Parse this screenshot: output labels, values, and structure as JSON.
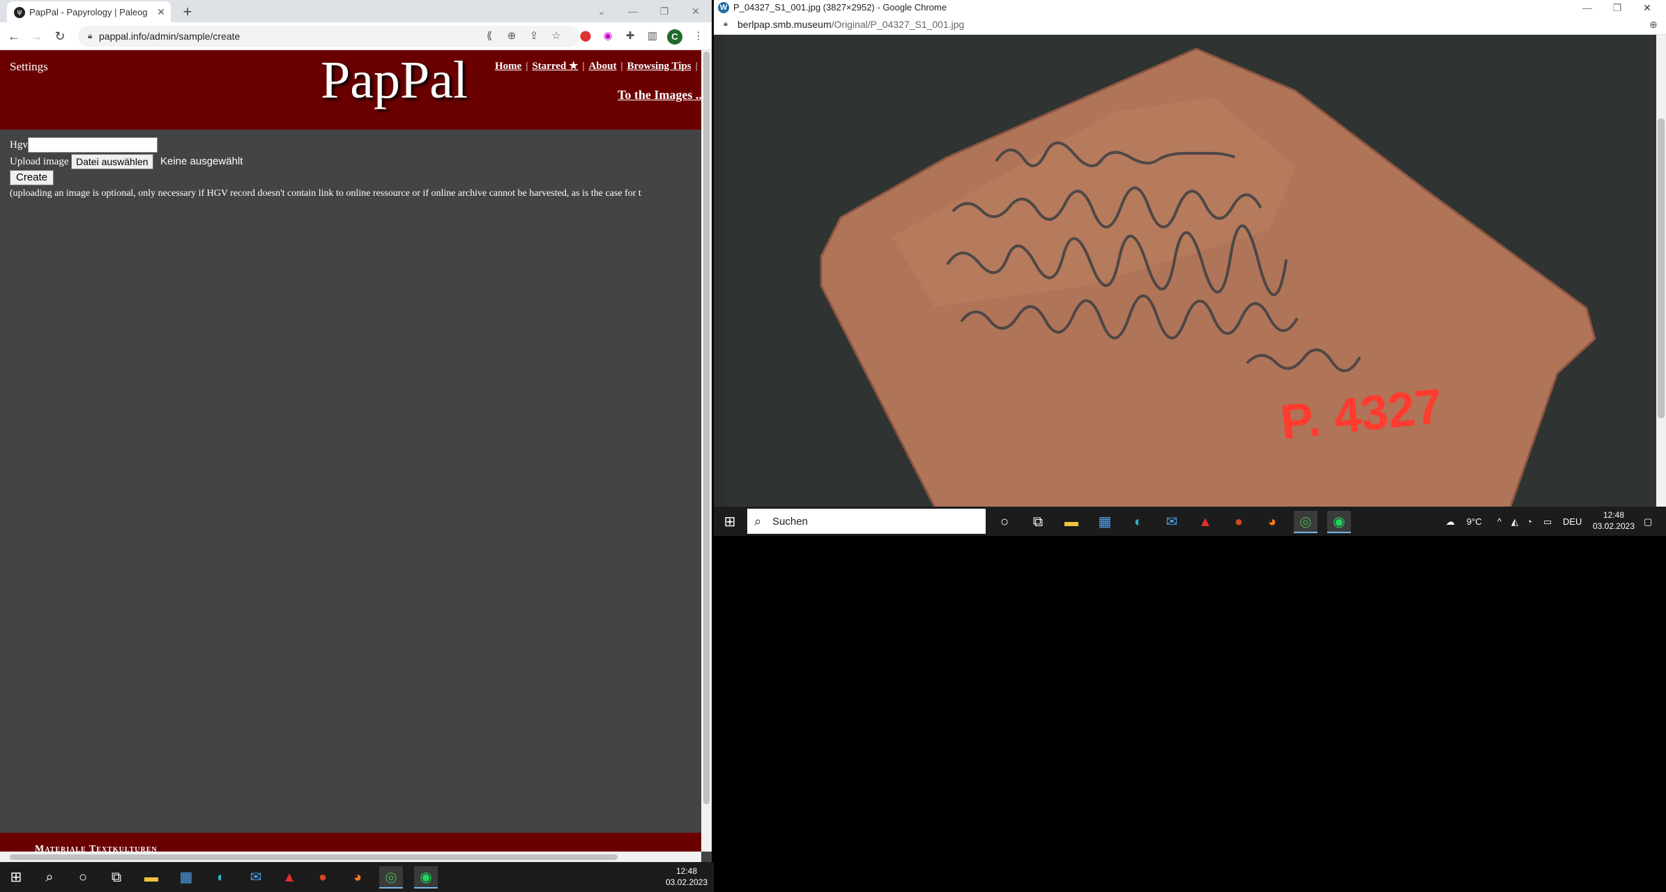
{
  "left_window": {
    "tab_title": "PapPal - Papyrology | Paleography",
    "tab_favicon": "ψ",
    "url": "pappal.info/admin/sample/create",
    "avatar_letter": "C",
    "page": {
      "settings": "Settings",
      "logo": "PapPal",
      "nav": [
        {
          "label": "Home"
        },
        {
          "label": "Starred ★"
        },
        {
          "label": "About"
        },
        {
          "label": "Browsing Tips"
        }
      ],
      "to_images": "To the Images ...",
      "form": {
        "hgv_label": "Hgv",
        "hgv_value": "",
        "upload_label": "Upload image",
        "file_button": "Datei auswählen",
        "file_status": "Keine ausgewählt",
        "create_button": "Create",
        "note": "(uploading an image is optional, only necessary if HGV record doesn't contain link to online ressource or if online archive cannot be harvested, as is the case for t"
      },
      "footer": "Materiale Textkulturen"
    }
  },
  "right_window": {
    "title": "P_04327_S1_001.jpg (3827×2952) - Google Chrome",
    "url_host": "berlpap.smb.museum",
    "url_path": "/Original/P_04327_S1_001.jpg",
    "image_label": "P. 4327"
  },
  "taskbar_right": {
    "search_placeholder": "Suchen",
    "weather": "9°C",
    "lang": "DEU",
    "time": "12:48",
    "date": "03.02.2023"
  },
  "taskbar_bottom": {
    "time": "12:48",
    "date": "03.02.2023"
  },
  "colors": {
    "banner": "#6b0000",
    "page_bg": "#444444",
    "taskbar": "#1c1c1c",
    "sherd": "#b07458",
    "ink": "#3d3f42",
    "stamp": "#ff3b30"
  }
}
